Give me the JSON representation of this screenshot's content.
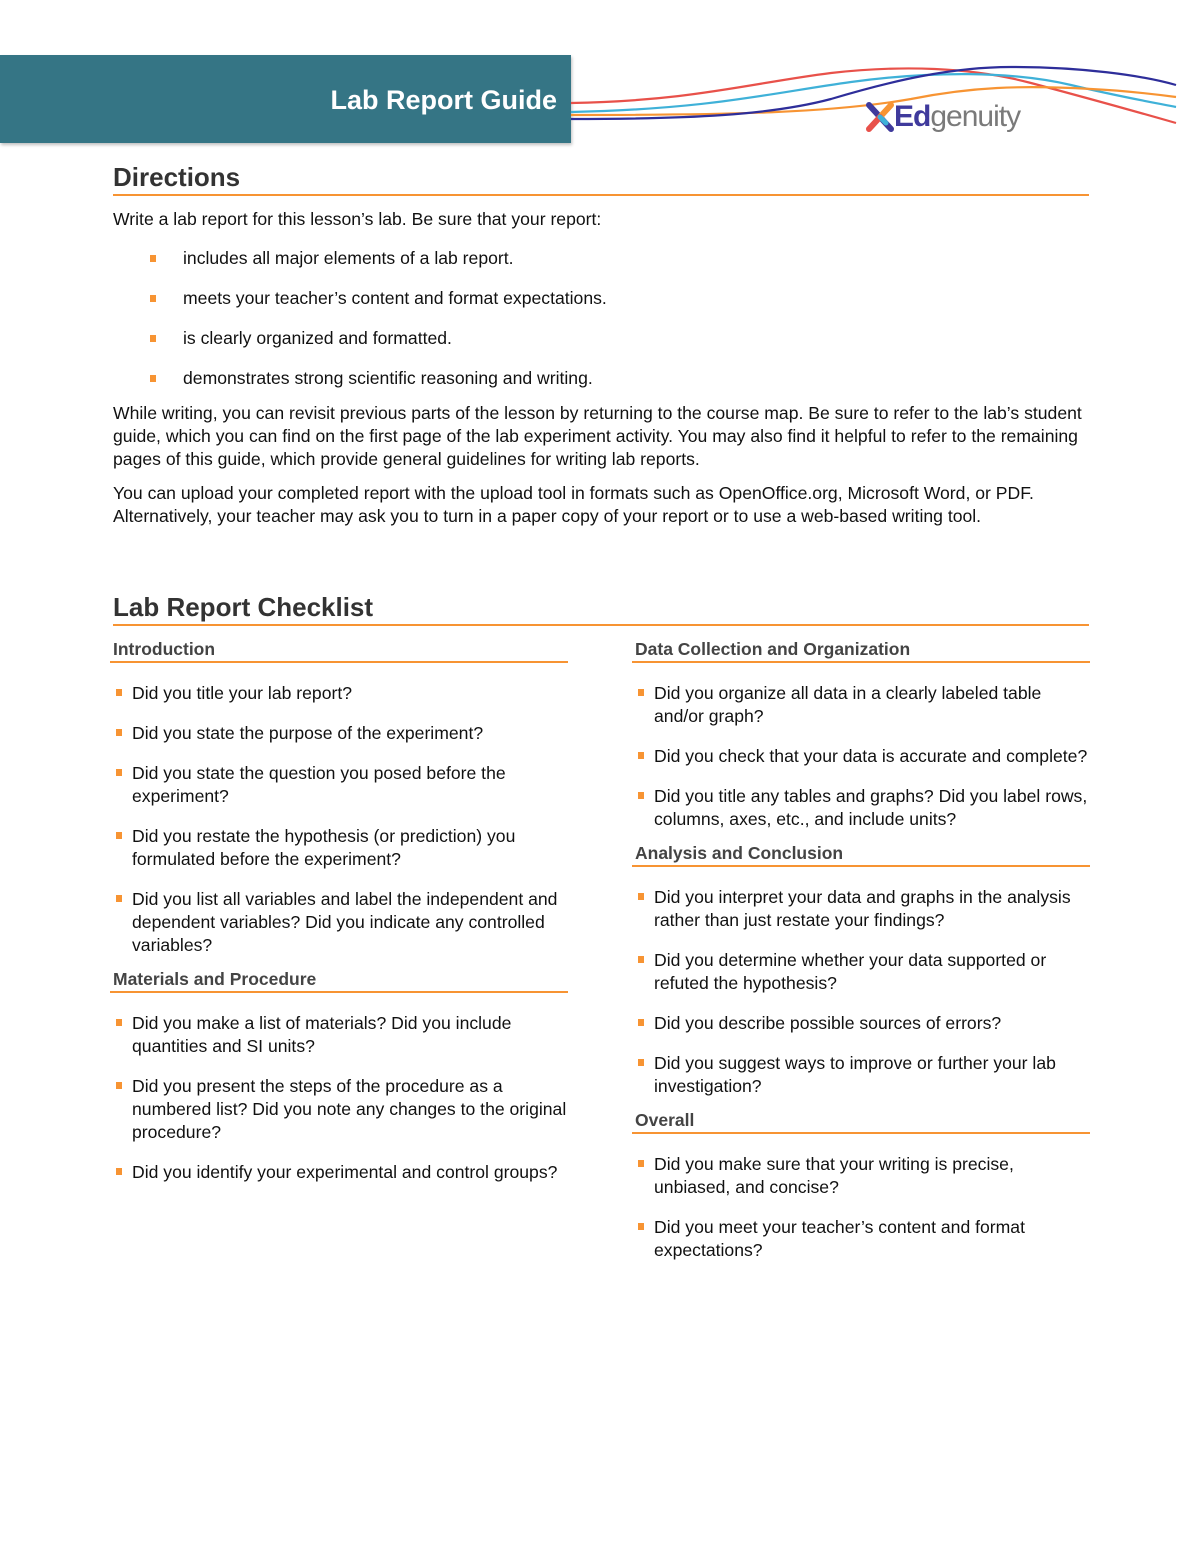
{
  "header": {
    "title": "Lab Report Guide",
    "brand_prefix": "Ed",
    "brand_suffix": "genuity",
    "banner_color": "#357585",
    "accent_color": "#f79433"
  },
  "directions": {
    "title": "Directions",
    "intro": "Write a lab report for this lesson’s lab. Be sure that your report:",
    "bullets": [
      "includes all major elements of a lab report.",
      "meets your teacher’s content and format expectations.",
      "is clearly organized and formatted.",
      "demonstrates strong scientific reasoning and writing."
    ],
    "paragraph_1": "While writing, you can revisit previous parts of the lesson by returning to the course map. Be sure to refer to the lab’s student guide, which you can find on the first page of the lab experiment activity. You may also find it helpful to refer to the remaining pages of this guide, which provide general guidelines for writing lab reports.",
    "paragraph_2": "You can upload your completed report with the upload tool in formats such as OpenOffice.org, Microsoft Word, or PDF. Alternatively, your teacher may ask you to turn in a paper copy of your report or to use a web-based writing tool."
  },
  "checklist": {
    "title": "Lab Report Checklist",
    "left": [
      {
        "heading": "Introduction",
        "items": [
          "Did you title your lab report?",
          "Did you state the purpose of the experiment?",
          "Did you state the question you posed before the experiment?",
          "Did you restate the hypothesis (or prediction) you formulated before the experiment?",
          "Did you list all variables and label the independent and dependent variables? Did you indicate any controlled variables?"
        ]
      },
      {
        "heading": "Materials and Procedure",
        "items": [
          "Did you make a list of materials? Did you include quantities and SI units?",
          "Did you present the steps of the procedure as a numbered list? Did you note any changes to the original procedure?",
          "Did you identify your experimental and control groups?"
        ]
      }
    ],
    "right": [
      {
        "heading": "Data Collection and Organization",
        "items": [
          "Did you organize all data in a clearly labeled table and/or graph?",
          "Did you check that your data is accurate and complete?",
          "Did you title any tables and graphs? Did you label rows, columns, axes, etc., and include units?"
        ]
      },
      {
        "heading": "Analysis and Conclusion",
        "items": [
          "Did you interpret your data and graphs in the analysis rather than just restate your findings?",
          "Did you determine whether your data supported or refuted the hypothesis?",
          "Did you describe possible sources of errors?",
          "Did you suggest ways to improve or further your lab investigation?"
        ]
      },
      {
        "heading": "Overall",
        "items": [
          "Did you make sure that your writing is precise, unbiased, and concise?",
          "Did you meet your teacher’s content and format expectations?"
        ]
      }
    ]
  }
}
